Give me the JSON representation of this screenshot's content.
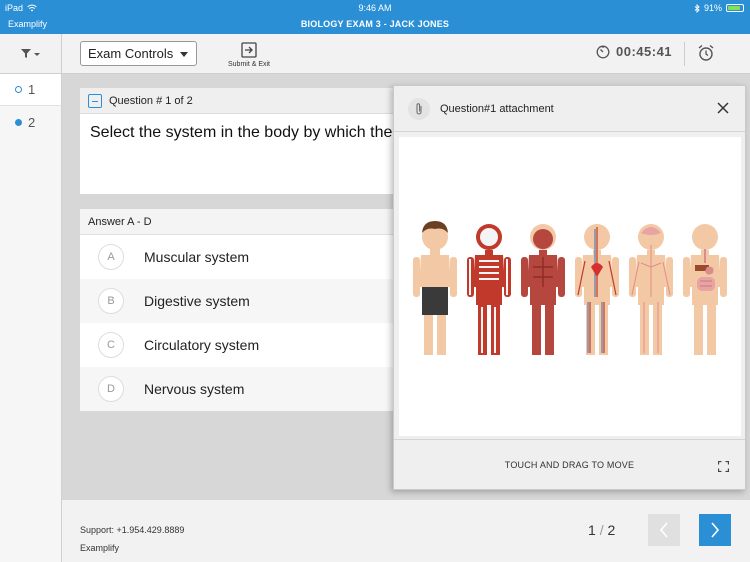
{
  "status_bar": {
    "device": "iPad",
    "time": "9:46 AM",
    "battery": "91%",
    "battery_level": 0.91
  },
  "title_bar": {
    "app_name": "Examplify",
    "exam_title": "BIOLOGY EXAM 3 - JACK JONES"
  },
  "toolbar": {
    "filter_icon": "filter-icon",
    "exam_controls_label": "Exam Controls",
    "submit_label": "Submit & Exit",
    "timer_value": "00:45:41"
  },
  "sidebar": {
    "items": [
      {
        "number": "1",
        "state": "unanswered"
      },
      {
        "number": "2",
        "state": "answered"
      }
    ]
  },
  "question": {
    "header": "Question # 1 of 2",
    "text": "Select the system in the body by which the b"
  },
  "answers": {
    "header": "Answer A - D",
    "options": [
      {
        "letter": "A",
        "text": "Muscular system"
      },
      {
        "letter": "B",
        "text": "Digestive system"
      },
      {
        "letter": "C",
        "text": "Circulatory system"
      },
      {
        "letter": "D",
        "text": "Nervous system"
      }
    ]
  },
  "attachment": {
    "title": "Question#1 attachment",
    "drag_hint": "TOUCH AND DRAG TO MOVE"
  },
  "footer": {
    "support": "Support: +1.954.429.8889",
    "brand": "Examplify",
    "current_page": "1",
    "total_pages": "2"
  },
  "colors": {
    "accent": "#2b8fd6",
    "toolbar_bg": "#f2f2f2",
    "backdrop": "#d7d7d7"
  }
}
